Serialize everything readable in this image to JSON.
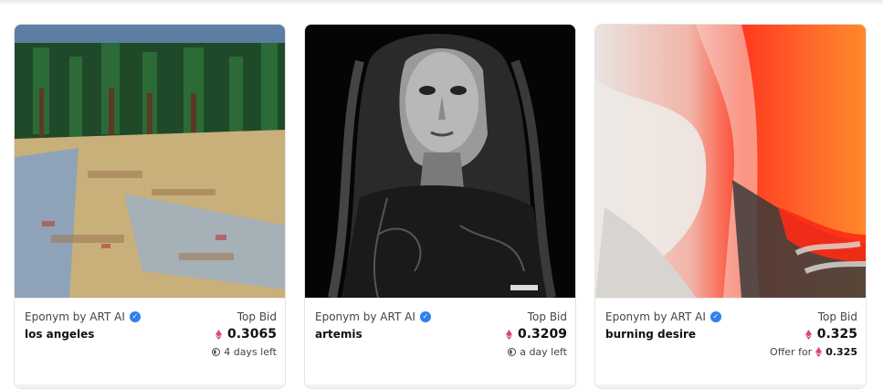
{
  "cards": [
    {
      "creator": "Eponym by ART AI",
      "title": "los angeles",
      "bid_label": "Top Bid",
      "bid_value": "0.3065",
      "meta": "4 days left",
      "meta_icon": "clock-icon",
      "image_desc_palette": [
        "#2b4d6b",
        "#1f4a2a",
        "#c9b07a",
        "#8fa3b8"
      ]
    },
    {
      "creator": "Eponym by ART AI",
      "title": "artemis",
      "bid_label": "Top Bid",
      "bid_value": "0.3209",
      "meta": "a day left",
      "meta_icon": "clock-icon",
      "image_desc_palette": [
        "#000000",
        "#3a3a3a",
        "#cfcfcf"
      ]
    },
    {
      "creator": "Eponym by ART AI",
      "title": "burning desire",
      "bid_label": "Top Bid",
      "bid_value": "0.325",
      "meta_prefix": "Offer for",
      "meta_value": "0.325",
      "meta_icon": "eth-icon",
      "image_desc_palette": [
        "#e9e3e0",
        "#ff3b1f",
        "#ff8a2a",
        "#444"
      ]
    }
  ],
  "colors": {
    "eth": "#e0427a",
    "verified": "#2f80ed"
  }
}
